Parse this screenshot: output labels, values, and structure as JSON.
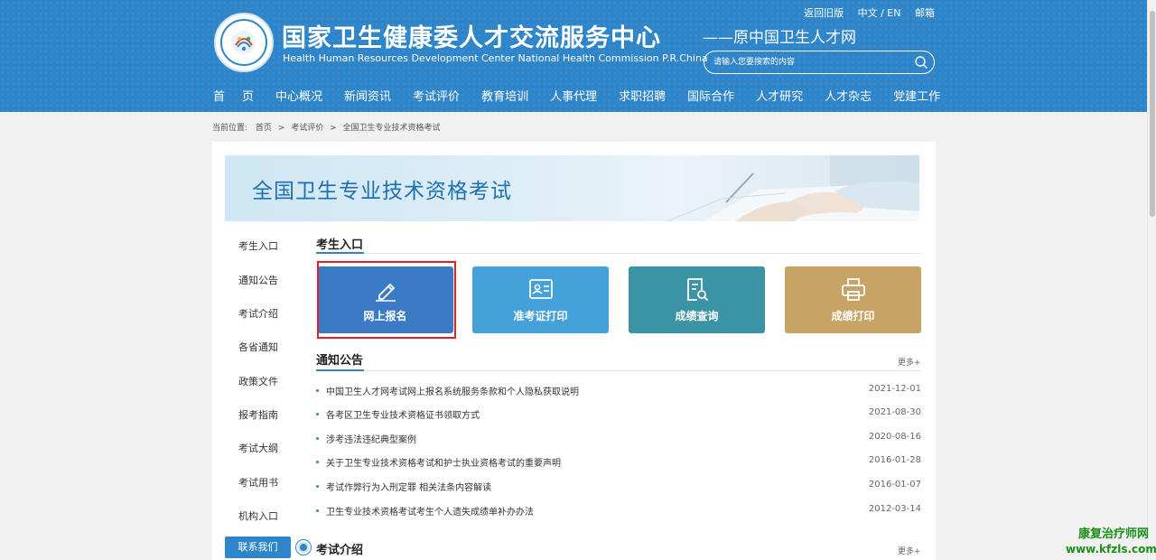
{
  "header": {
    "title": "国家卫生健康委人才交流服务中心",
    "subtitle": "Health Human Resources Development Center National Health Commission P.R.China",
    "slogan": "——原中国卫生人才网",
    "top_links": [
      "返回旧版",
      "中文 / EN",
      "邮箱"
    ],
    "search_placeholder": "请输入您要搜索的内容",
    "nav": [
      "首页",
      "中心概况",
      "新闻资讯",
      "考试评价",
      "教育培训",
      "人事代理",
      "求职招聘",
      "国际合作",
      "人才研究",
      "人才杂志",
      "党建工作"
    ]
  },
  "breadcrumb": {
    "label": "当前位置:",
    "items": [
      "首页",
      "考试评价",
      "全国卫生专业技术资格考试"
    ]
  },
  "banner": {
    "title": "全国卫生专业技术资格考试"
  },
  "sidebar": {
    "items": [
      "考生入口",
      "通知公告",
      "考试介绍",
      "各省通知",
      "政策文件",
      "报考指南",
      "考试大纲",
      "考试用书",
      "机构入口"
    ],
    "contact": "联系我们"
  },
  "entry": {
    "title": "考生入口",
    "tiles": [
      {
        "label": "网上报名",
        "icon": "edit-icon",
        "color": "#3b7ac4"
      },
      {
        "label": "准考证打印",
        "icon": "id-card-icon",
        "color": "#45a1d9"
      },
      {
        "label": "成绩查询",
        "icon": "document-search-icon",
        "color": "#3b94a6"
      },
      {
        "label": "成绩打印",
        "icon": "printer-icon",
        "color": "#c7a466"
      }
    ]
  },
  "notices": {
    "title": "通知公告",
    "more": "更多+",
    "items": [
      {
        "title": "中国卫生人才网考试网上报名系统服务条款和个人隐私获取说明",
        "date": "2021-12-01"
      },
      {
        "title": "各考区卫生专业技术资格证书领取方式",
        "date": "2021-08-30"
      },
      {
        "title": "涉考违法违纪典型案例",
        "date": "2020-08-16"
      },
      {
        "title": "关于卫生专业技术资格考试和护士执业资格考试的重要声明",
        "date": "2016-01-28"
      },
      {
        "title": "考试作弊行为入刑定罪 相关法条内容解读",
        "date": "2016-01-07"
      },
      {
        "title": "卫生专业技术资格考试考生个人遗失成绩单补办办法",
        "date": "2012-03-14"
      }
    ]
  },
  "intro": {
    "title": "考试介绍",
    "more": "更多+"
  },
  "watermark": {
    "line1": "康复治疗师网",
    "line2": "www.kfzls.com"
  }
}
